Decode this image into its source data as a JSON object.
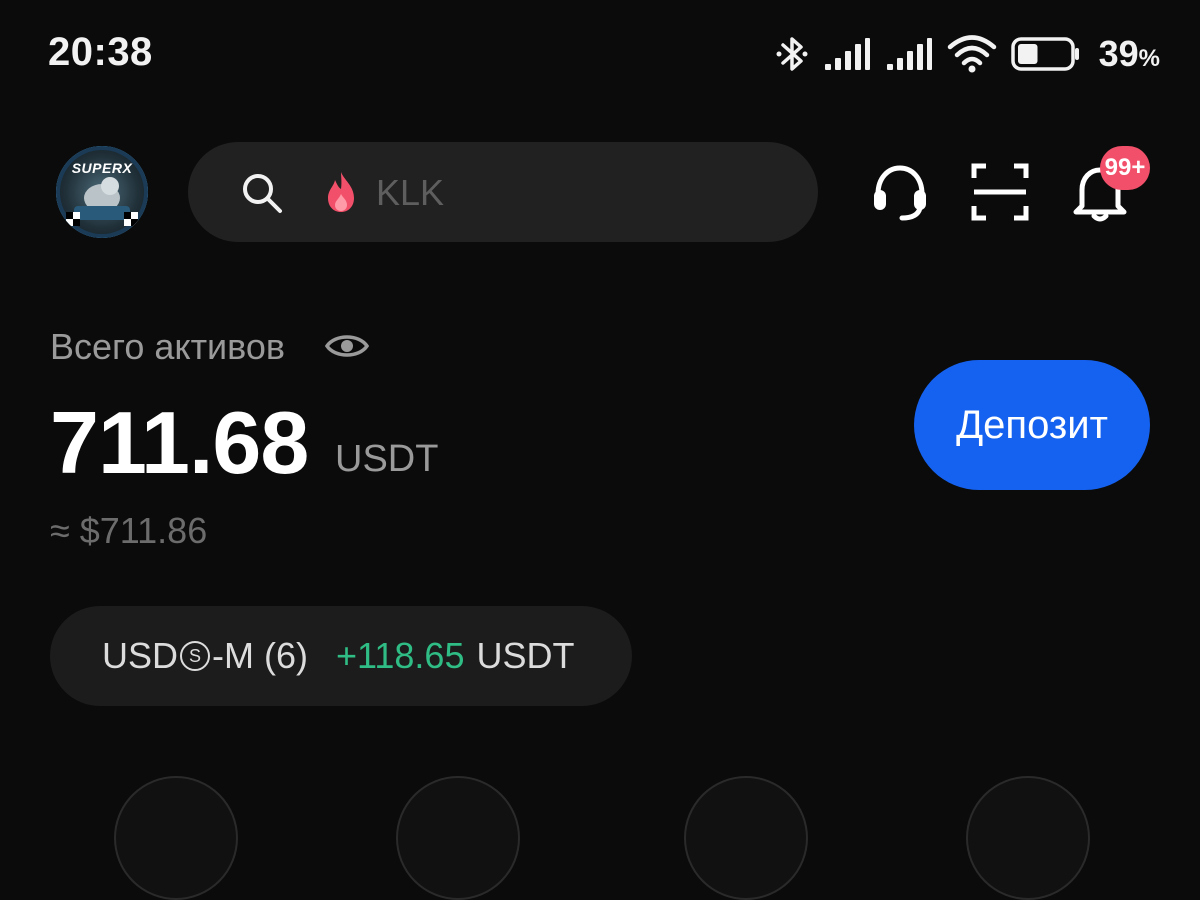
{
  "status_bar": {
    "time": "20:38",
    "battery_percent": "39",
    "battery_symbol": "%",
    "battery_level": 0.39
  },
  "header": {
    "avatar_text": "SUPERX",
    "search": {
      "placeholder": "KLK"
    },
    "notification_badge": "99+"
  },
  "assets": {
    "label": "Всего активов",
    "amount": "711.68",
    "unit": "USDT",
    "approx": "≈ $711.86",
    "deposit_label": "Депозит"
  },
  "position": {
    "name_prefix": "USD",
    "name_symbol": "S",
    "name_suffix": "-M (6)",
    "pnl": "+118.65",
    "pnl_unit": "USDT"
  },
  "colors": {
    "background": "#0b0b0b",
    "accent_blue": "#1562f0",
    "profit_green": "#2fbd85",
    "badge_red": "#f2506a",
    "fire": "#f2506a"
  },
  "icons": [
    "bluetooth-icon",
    "signal-icon",
    "wifi-icon",
    "battery-icon",
    "search-icon",
    "fire-icon",
    "headset-icon",
    "scan-icon",
    "bell-icon",
    "eye-icon"
  ]
}
